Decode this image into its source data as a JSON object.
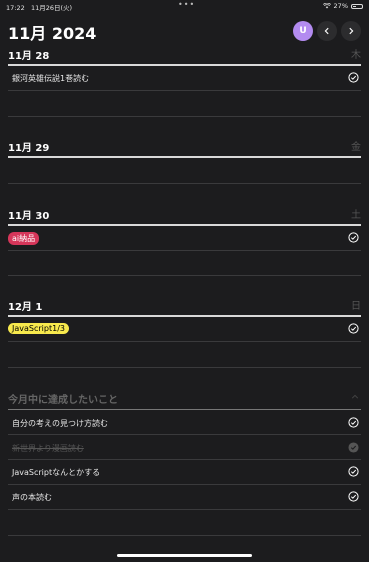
{
  "status_bar": {
    "time": "17:22",
    "date": "11月26日(火)",
    "dots": "•••",
    "battery": "27%"
  },
  "header": {
    "title": "11月 2024",
    "avatar_letter": "U"
  },
  "days": [
    {
      "title": "11月 28",
      "weekday": "木",
      "tasks": [
        {
          "text": "銀河英雄伝説1巻読む",
          "done": false
        }
      ]
    },
    {
      "title": "11月 29",
      "weekday": "金",
      "tasks": []
    },
    {
      "title": "11月 30",
      "weekday": "土",
      "tasks": [
        {
          "tag": "ai納品",
          "tag_color": "#d6365a",
          "done": false
        }
      ]
    },
    {
      "title": "12月 1",
      "weekday": "日",
      "tasks": [
        {
          "tag": "JavaScript1/3",
          "tag_color": "#f7e94d",
          "done": false
        }
      ]
    }
  ],
  "monthly_goals": {
    "title": "今月中に達成したいこと",
    "items": [
      {
        "text": "自分の考えの見つけ方読む",
        "done": false
      },
      {
        "text": "新世界より漫画読む",
        "done": true
      },
      {
        "text": "JavaScriptなんとかする",
        "done": false
      },
      {
        "text": "声の本読む",
        "done": false
      }
    ]
  },
  "colors": {
    "background": "#1c1c1e",
    "avatar": "#b38bf0",
    "tag_red": "#d6365a",
    "tag_yellow": "#f7e94d"
  }
}
